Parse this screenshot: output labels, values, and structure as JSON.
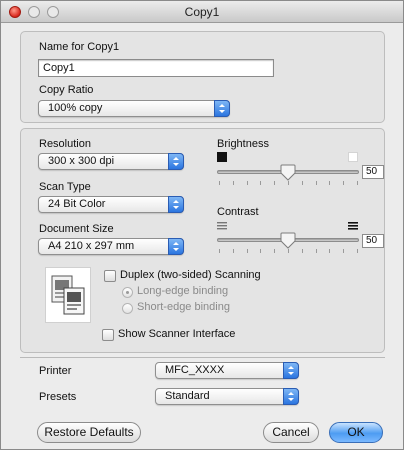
{
  "window": {
    "title": "Copy1"
  },
  "name_section": {
    "label": "Name for Copy1",
    "value": "Copy1"
  },
  "copy_ratio": {
    "label": "Copy Ratio",
    "selected": "100% copy"
  },
  "resolution": {
    "label": "Resolution",
    "selected": "300 x 300 dpi"
  },
  "scan_type": {
    "label": "Scan Type",
    "selected": "24 Bit Color"
  },
  "document_size": {
    "label": "Document Size",
    "selected": "A4  210 x 297 mm"
  },
  "brightness": {
    "label": "Brightness",
    "value": "50",
    "level": 0.5
  },
  "contrast": {
    "label": "Contrast",
    "value": "50",
    "level": 0.5
  },
  "duplex": {
    "label": "Duplex (two-sided) Scanning",
    "checked": false,
    "options": [
      "Long-edge binding",
      "Short-edge binding"
    ],
    "selected_index": 0
  },
  "show_scanner_interface": {
    "label": "Show Scanner Interface",
    "checked": false
  },
  "printer": {
    "label": "Printer",
    "selected": "MFC_XXXX"
  },
  "presets": {
    "label": "Presets",
    "selected": "Standard"
  },
  "buttons": {
    "restore_defaults": "Restore Defaults",
    "cancel": "Cancel",
    "ok": "OK"
  },
  "colors": {
    "accent": "#2b75e0",
    "close": "#d9261c"
  }
}
